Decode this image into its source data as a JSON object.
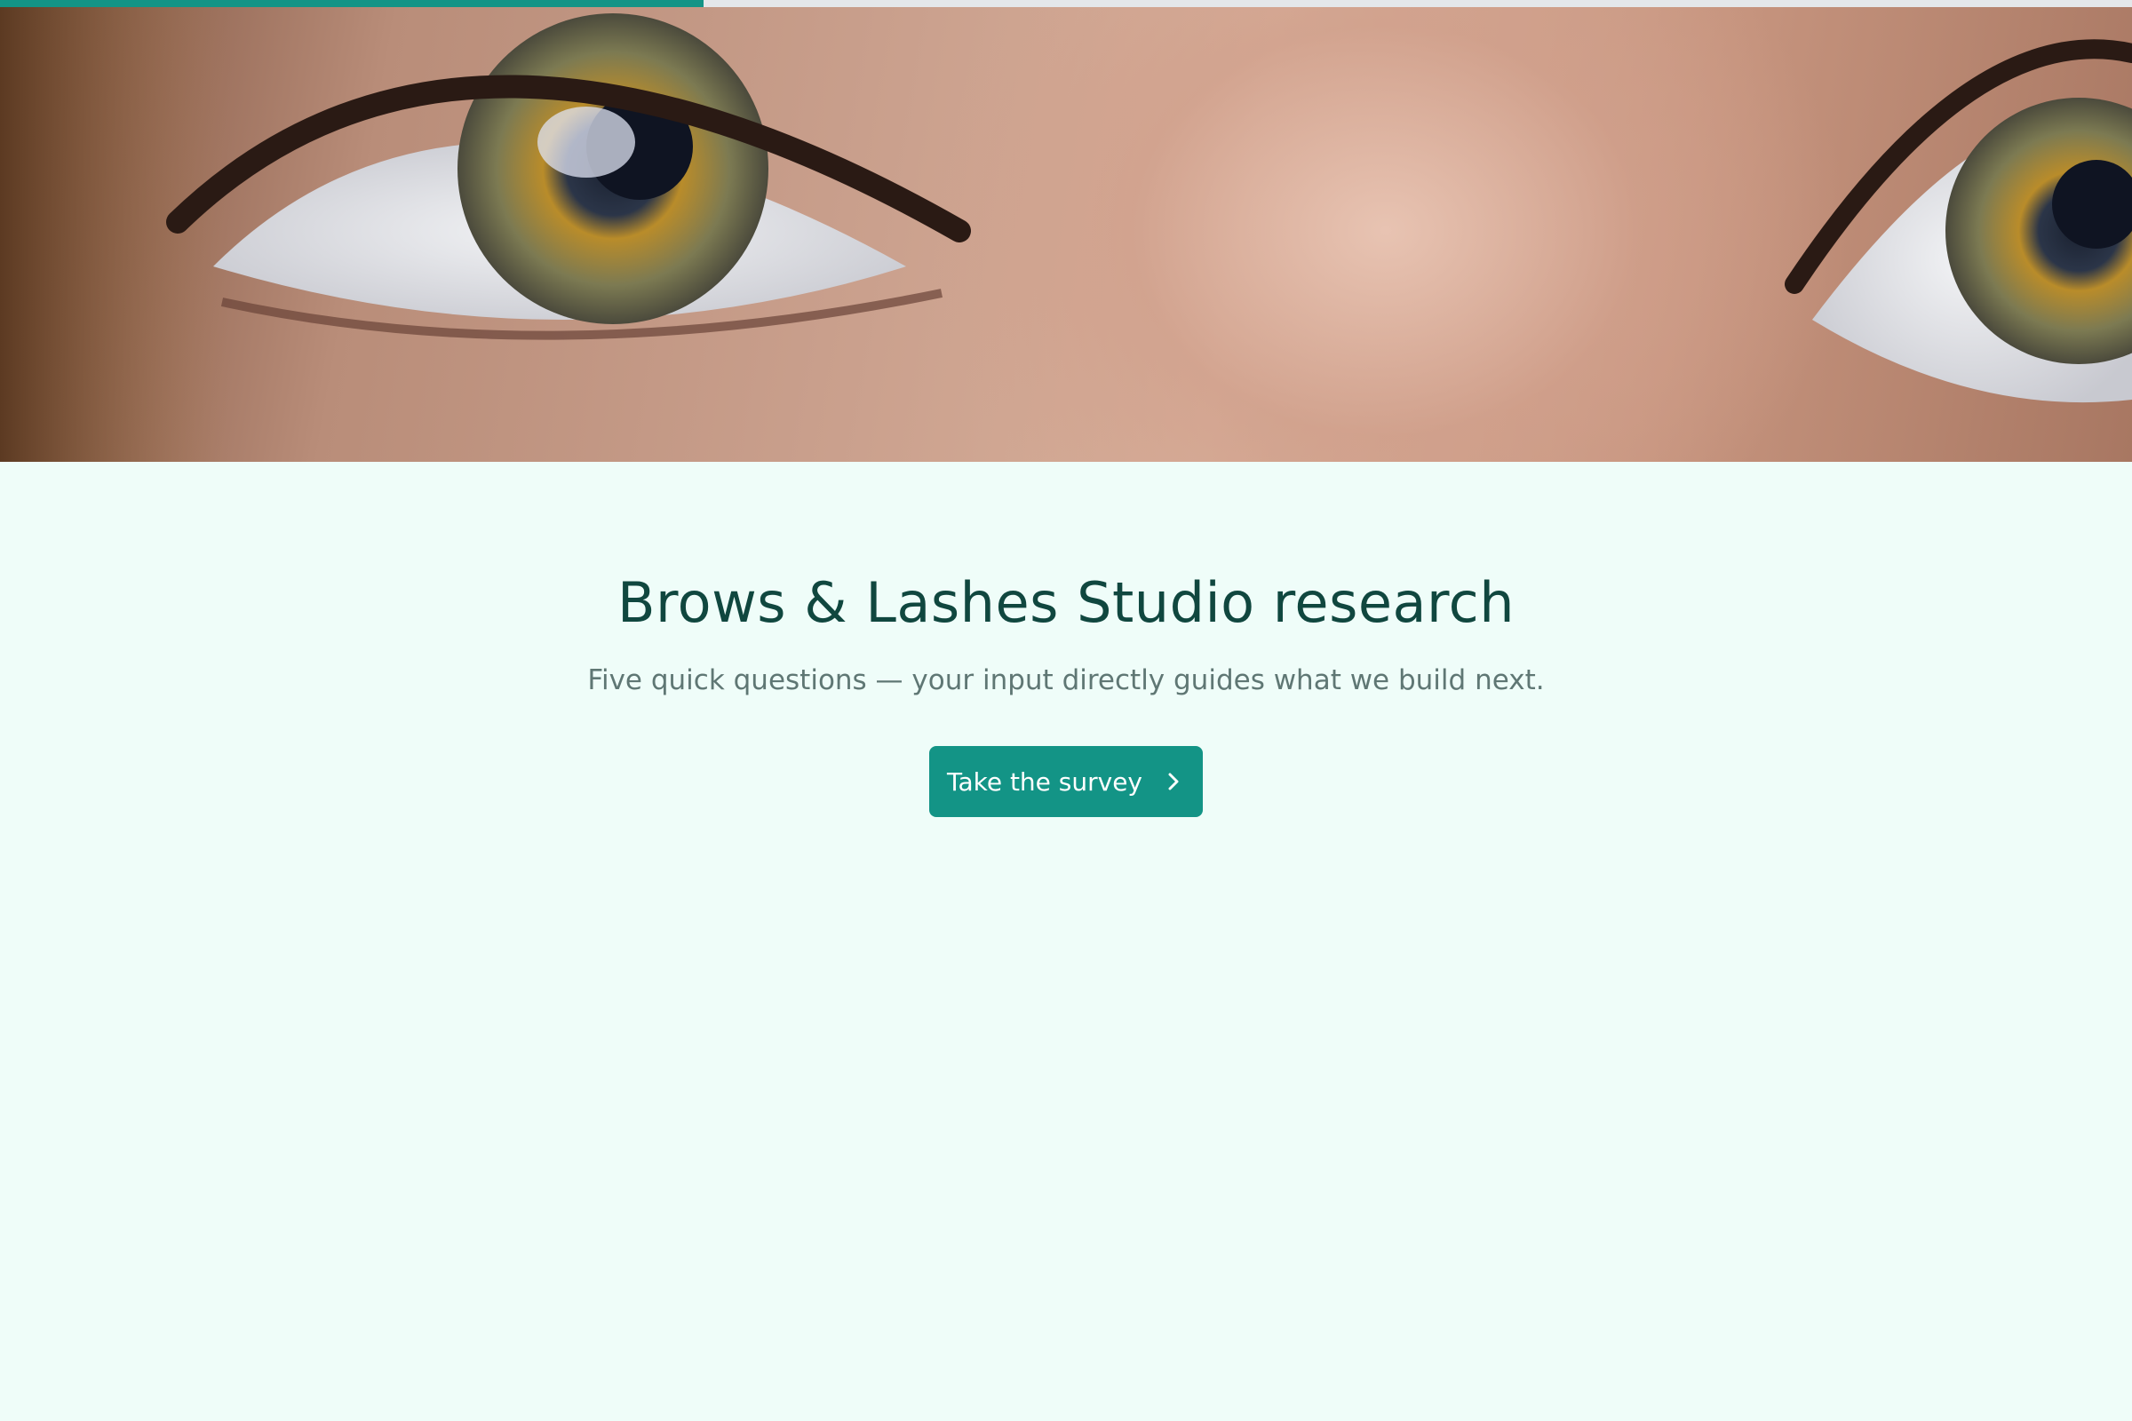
{
  "progress": {
    "fraction": 0.33,
    "fill_color": "#139486",
    "track_color": "#e4e7ea"
  },
  "hero": {
    "image_subject": "close-up of a woman's eyes with long lashes"
  },
  "main": {
    "title": "Brows & Lashes Studio research",
    "subtitle": "Five quick questions — your input directly guides what we build next.",
    "cta_label": "Take the survey",
    "cta_icon": "chevron-right-icon"
  },
  "colors": {
    "background": "#effdf9",
    "accent": "#139486",
    "title": "#10473f",
    "subtitle": "#5f7774"
  }
}
